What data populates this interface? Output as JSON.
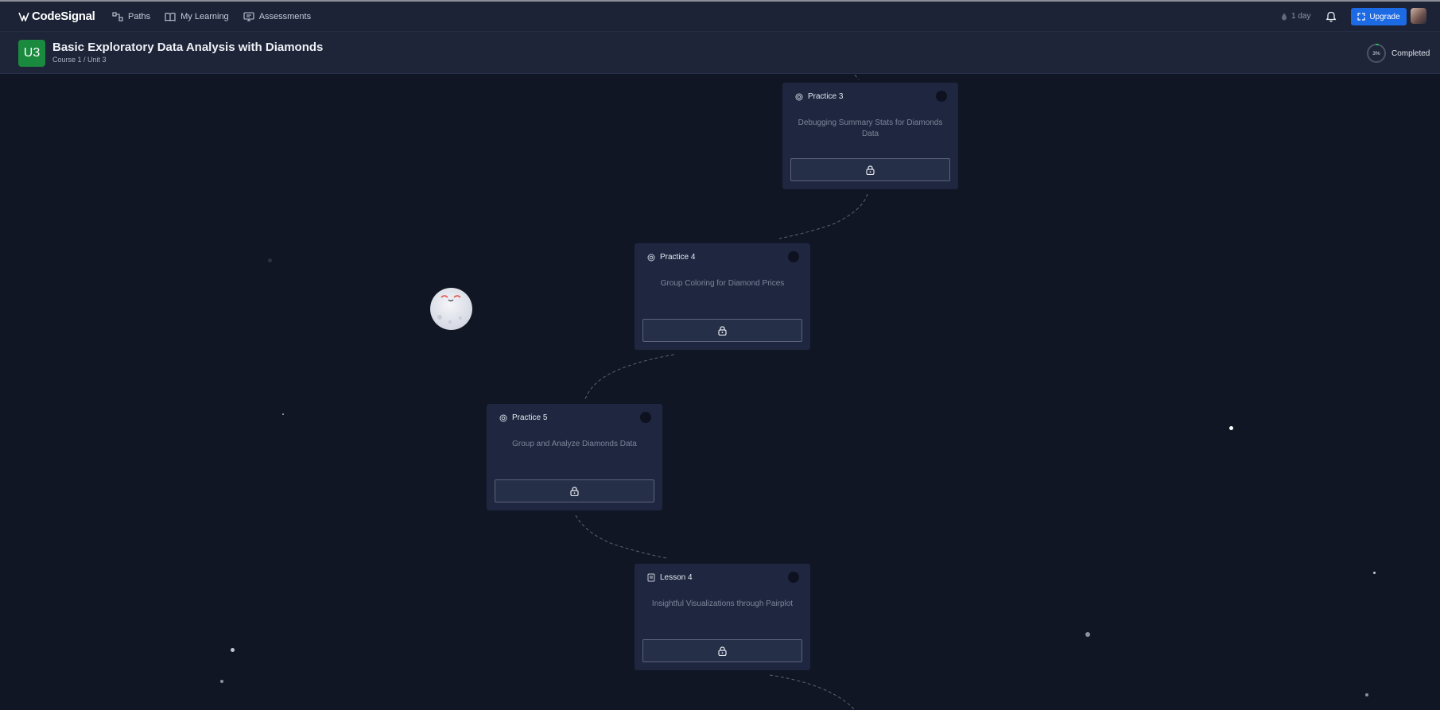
{
  "topbar": {
    "logo_text": "CodeSignal",
    "nav": [
      {
        "label": "Paths",
        "icon": "paths-icon"
      },
      {
        "label": "My Learning",
        "icon": "book-icon"
      },
      {
        "label": "Assessments",
        "icon": "assessment-icon"
      }
    ],
    "streak": "1 day",
    "upgrade_label": "Upgrade"
  },
  "unit": {
    "badge": "U3",
    "title": "Basic Exploratory Data Analysis with Diamonds",
    "breadcrumb": "Course 1 / Unit 3",
    "progress_pct": "3%",
    "progress_fraction": 0.03,
    "progress_label": "Completed"
  },
  "cards": [
    {
      "kind": "Practice 3",
      "icon": "practice-icon",
      "title": "Debugging Summary Stats for Diamonds Data",
      "locked": true
    },
    {
      "kind": "Practice 4",
      "icon": "practice-icon",
      "title": "Group Coloring for Diamond Prices",
      "locked": true
    },
    {
      "kind": "Practice 5",
      "icon": "practice-icon",
      "title": "Group and Analyze Diamonds Data",
      "locked": true
    },
    {
      "kind": "Lesson 4",
      "icon": "lesson-icon",
      "title": "Insightful Visualizations through Pairplot",
      "locked": true
    }
  ],
  "colors": {
    "background": "#111625",
    "topbar": "#1c2336",
    "card": "#1f2740",
    "accent_blue": "#1d6ae5",
    "unit_badge_green": "#1a8a3f"
  }
}
